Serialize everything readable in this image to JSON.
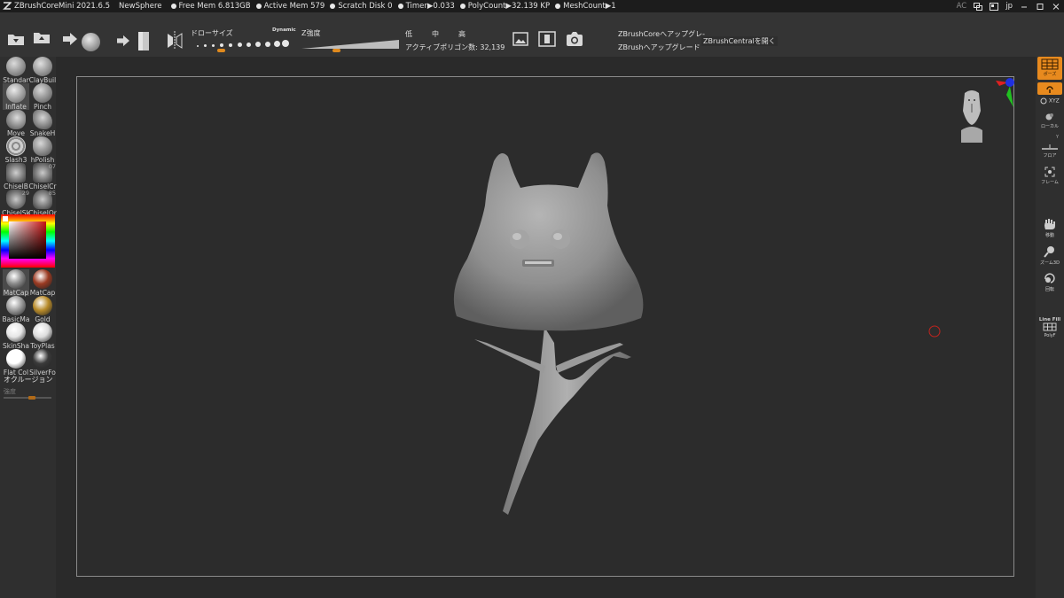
{
  "titlebar": {
    "app": "ZBrushCoreMini 2021.6.5",
    "document": "NewSphere",
    "free_mem": "Free Mem 6.813GB",
    "active_mem": "Active Mem 579",
    "scratch_disk": "Scratch Disk 0",
    "timer": "Timer▶0.033",
    "polycount": "PolyCount▶32.139 KP",
    "meshcount": "MeshCount▶1",
    "ac": "AC",
    "lang": "jp"
  },
  "toolbar": {
    "draw_size_label": "ドローサイズ",
    "dynamic_label": "Dynamic",
    "z_intensity_label": "Z強度",
    "res_low": "低",
    "res_mid": "中",
    "res_high": "高",
    "active_polys": "アクティブポリゴン数: 32,139",
    "upgrade_core": "ZBrushCoreへアップグレ-",
    "upgrade_zbrush": "ZBrushへアップグレード",
    "open_central": "ZBrushCentralを開く",
    "draw_size_value": 0.25,
    "z_intensity_value": 0.35
  },
  "brushes": [
    {
      "name": "Standar"
    },
    {
      "name": "ClayBuil"
    },
    {
      "name": "Inflate",
      "selected": true
    },
    {
      "name": "Pinch"
    },
    {
      "name": "Move"
    },
    {
      "name": "SnakeH"
    },
    {
      "name": "Slash3"
    },
    {
      "name": "hPolish"
    },
    {
      "name": "ChiselB"
    },
    {
      "name": "ChiselCr",
      "badge": "07"
    },
    {
      "name": "ChiselSk",
      "badge": "29"
    },
    {
      "name": "ChiselOr",
      "badge": "85"
    }
  ],
  "materials": [
    {
      "name": "MatCap",
      "color": "#8a8a8a",
      "selected": true
    },
    {
      "name": "MatCap",
      "color": "#9a3a22"
    },
    {
      "name": "BasicMa",
      "color": "#9c9c9c"
    },
    {
      "name": "Gold",
      "color": "#b88b2a"
    },
    {
      "name": "SkinSha",
      "color": "#e6e6e6"
    },
    {
      "name": "ToyPlas",
      "color": "#dddddd"
    },
    {
      "name": "Flat Col",
      "color": "#ffffff"
    },
    {
      "name": "SilverFo",
      "color": "#3a3a3a"
    }
  ],
  "occlusion_label": "オクルージョン",
  "strength_label": "強度",
  "strength_value": 0.6,
  "right_shelf": {
    "pose": "ポーズ",
    "xyz": "XYZ",
    "local": "ローカル",
    "y_label": "Y",
    "floor": "フロア",
    "frame": "フレーム",
    "move": "移動",
    "zoom3d": "ズーム3D",
    "rotate": "回転",
    "linefill_1": "Line Fill",
    "linefill_2": "PolyF"
  },
  "colors": {
    "accent": "#e08a1e",
    "ui_bg": "#2a2a2a",
    "toolbar_bg": "#343434",
    "canvas_border": "#8a8a8a"
  }
}
